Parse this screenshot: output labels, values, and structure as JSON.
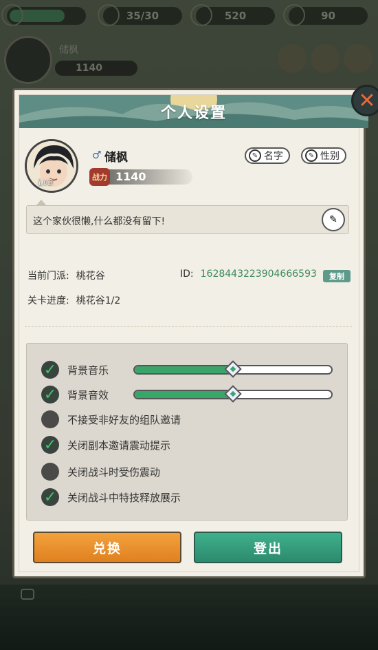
{
  "top_resources": [
    {
      "icon": "energy-icon",
      "value": ""
    },
    {
      "icon": "stamina-icon",
      "value": "35/30"
    },
    {
      "icon": "coin-icon",
      "value": "520"
    },
    {
      "icon": "jade-icon",
      "value": "90"
    }
  ],
  "top_player": {
    "name": "储枫",
    "power": "1140"
  },
  "dialog": {
    "title": "个人设置",
    "close_icon": "close-icon",
    "profile": {
      "name": "储枫",
      "gender_symbol": "♂",
      "level": "Lv3",
      "power_badge": "战力",
      "power": "1140",
      "rename_label": "名字",
      "gender_label": "性别",
      "signature": "这个家伙很懒,什么都没有留下!"
    },
    "info": {
      "sect_label": "当前门派:",
      "sect_value": "桃花谷",
      "id_label": "ID:",
      "id_value": "1628443223904666593",
      "copy_label": "复制",
      "progress_label": "关卡进度:",
      "progress_value": "桃花谷1/2"
    },
    "settings": [
      {
        "label": "背景音乐",
        "checked": true,
        "slider": 0.5
      },
      {
        "label": "背景音效",
        "checked": true,
        "slider": 0.5
      },
      {
        "label": "不接受非好友的组队邀请",
        "checked": false
      },
      {
        "label": "关闭副本邀请震动提示",
        "checked": true
      },
      {
        "label": "关闭战斗时受伤震动",
        "checked": false
      },
      {
        "label": "关闭战斗中特技释放展示",
        "checked": true
      }
    ],
    "buttons": {
      "exchange": "兑换",
      "logout": "登出"
    }
  },
  "colors": {
    "accent_green": "#3aa56a",
    "exchange_orange": "#f3a23d",
    "logout_green": "#3fb08c",
    "close_orange": "#e8693a"
  }
}
